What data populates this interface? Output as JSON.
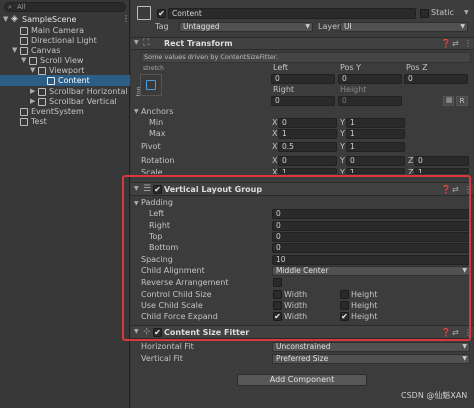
{
  "hierarchy": {
    "search_placeholder": "All",
    "items": [
      {
        "label": "SampleScene"
      },
      {
        "label": "Main Camera"
      },
      {
        "label": "Directional Light"
      },
      {
        "label": "Canvas"
      },
      {
        "label": "Scroll View"
      },
      {
        "label": "Viewport"
      },
      {
        "label": "Content"
      },
      {
        "label": "Scrollbar Horizontal"
      },
      {
        "label": "Scrollbar Vertical"
      },
      {
        "label": "EventSystem"
      },
      {
        "label": "Test"
      }
    ]
  },
  "inspector": {
    "object_name": "Content",
    "static_label": "Static",
    "tag_label": "Tag",
    "tag_value": "Untagged",
    "layer_label": "Layer",
    "layer_value": "UI",
    "rect_transform": {
      "title": "Rect Transform",
      "notice": "Some values driven by ContentSizeFitter.",
      "anchor_preset_top": "stretch",
      "anchor_preset_side": "top",
      "col_left": "Left",
      "col_posy": "Pos Y",
      "col_posz": "Pos Z",
      "val_left": "0",
      "val_posy": "0",
      "val_posz": "0",
      "col_right": "Right",
      "col_height": "Height",
      "val_right": "0",
      "val_height": "0",
      "button_r": "R",
      "anchors": "Anchors",
      "min": "Min",
      "max": "Max",
      "min_x": "0",
      "min_y": "1",
      "max_x": "1",
      "max_y": "1",
      "pivot": "Pivot",
      "pivot_x": "0.5",
      "pivot_y": "1",
      "rotation": "Rotation",
      "rot_x": "0",
      "rot_y": "0",
      "rot_z": "0",
      "scale": "Scale",
      "scale_x": "1",
      "scale_y": "1",
      "scale_z": "1",
      "x": "X",
      "y": "Y",
      "z": "Z"
    },
    "vlg": {
      "title": "Vertical Layout Group",
      "padding": "Padding",
      "left": "Left",
      "right": "Right",
      "top": "Top",
      "bottom": "Bottom",
      "left_val": "0",
      "right_val": "0",
      "top_val": "0",
      "bottom_val": "0",
      "spacing": "Spacing",
      "spacing_val": "10",
      "child_alignment": "Child Alignment",
      "child_alignment_val": "Middle Center",
      "reverse": "Reverse Arrangement",
      "control_size": "Control Child Size",
      "use_scale": "Use Child Scale",
      "force_expand": "Child Force Expand",
      "width": "Width",
      "height": "Height",
      "check_mark": "✔"
    },
    "csf": {
      "title": "Content Size Fitter",
      "horizontal": "Horizontal Fit",
      "horizontal_val": "Unconstrained",
      "vertical": "Vertical Fit",
      "vertical_val": "Preferred Size"
    },
    "add_component": "Add Component",
    "watermark": "CSDN @仙魁XAN"
  },
  "colors": {
    "selection": "#2c5d87",
    "highlight": "#d8373f",
    "panel": "#3c3c3c"
  }
}
